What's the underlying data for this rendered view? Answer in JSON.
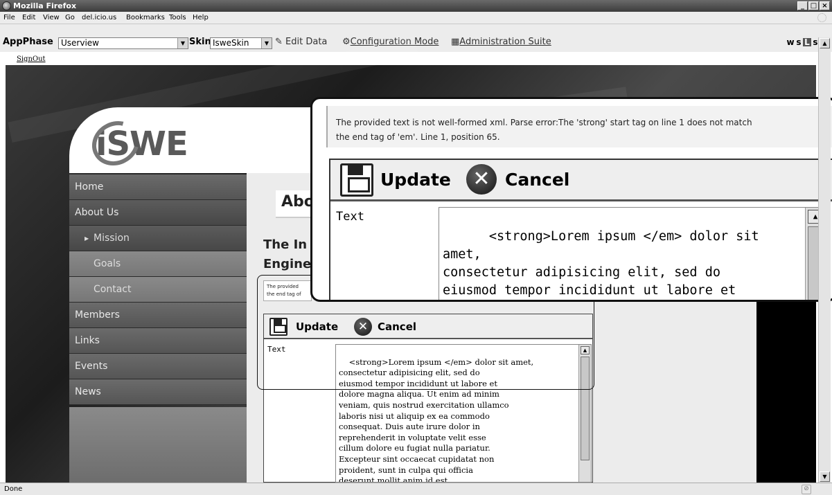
{
  "window": {
    "title": "Mozilla Firefox",
    "min": "_",
    "max": "□",
    "close": "×"
  },
  "menu": [
    "File",
    "Edit",
    "View",
    "Go",
    "del.icio.us",
    "Bookmarks",
    "Tools",
    "Help"
  ],
  "toolbar": {
    "appphase_label": "AppPhase",
    "appphase_value": "Userview",
    "skin_label": "Skin",
    "skin_value": "IsweSkin",
    "edit_data": "Edit Data",
    "config_mode": "Configuration Mode",
    "admin_suite": "Administration Suite",
    "wsls": [
      "w",
      "s",
      "L",
      "s"
    ]
  },
  "signout": "SignOut",
  "logo_text": "iSWE",
  "nav": [
    {
      "label": "Home"
    },
    {
      "label": "About Us"
    },
    {
      "label": "Mission"
    },
    {
      "label": "Goals"
    },
    {
      "label": "Contact"
    },
    {
      "label": "Members"
    },
    {
      "label": "Links"
    },
    {
      "label": "Events"
    },
    {
      "label": "News"
    }
  ],
  "content": {
    "title": "Abo",
    "subtitle_line1": "The In",
    "subtitle_line2": "Engine",
    "error_small_line1": "The provided",
    "error_small_line2": "the end tag of"
  },
  "editor": {
    "update_label": "Update",
    "cancel_label": "Cancel",
    "text_label": "Text",
    "text_value": "<strong>Lorem ipsum </em> dolor sit amet,\nconsectetur adipisicing elit, sed do\neiusmod tempor incididunt ut labore et\ndolore magna aliqua. Ut enim ad minim\nveniam, quis nostrud exercitation ullamco\nlaboris nisi ut aliquip ex ea commodo\nconsequat. Duis aute irure dolor in\nreprehenderit in voluptate velit esse\ncillum dolore eu fugiat nulla pariatur.\nExcepteur sint occaecat cupidatat non\nproident, sunt in culpa qui officia\ndeserunt mollit anim id est"
  },
  "zoom": {
    "error_line1": "The provided text is not well-formed xml. Parse error:The 'strong' start tag on line 1 does not match",
    "error_line2": "the end tag of 'em'. Line 1, position 65.",
    "update_label": "Update",
    "cancel_label": "Cancel",
    "text_label": "Text",
    "text_value": "<strong>Lorem ipsum </em> dolor sit amet,\nconsectetur adipisicing elit, sed do\neiusmod tempor incididunt ut labore et\ndolore magna aliqua. Ut enim ad minim\nveniam, quis nostrud exercitation ullamco\nlaboris nisi ut aliquip ex ea commodo"
  },
  "status": {
    "text": "Done"
  }
}
